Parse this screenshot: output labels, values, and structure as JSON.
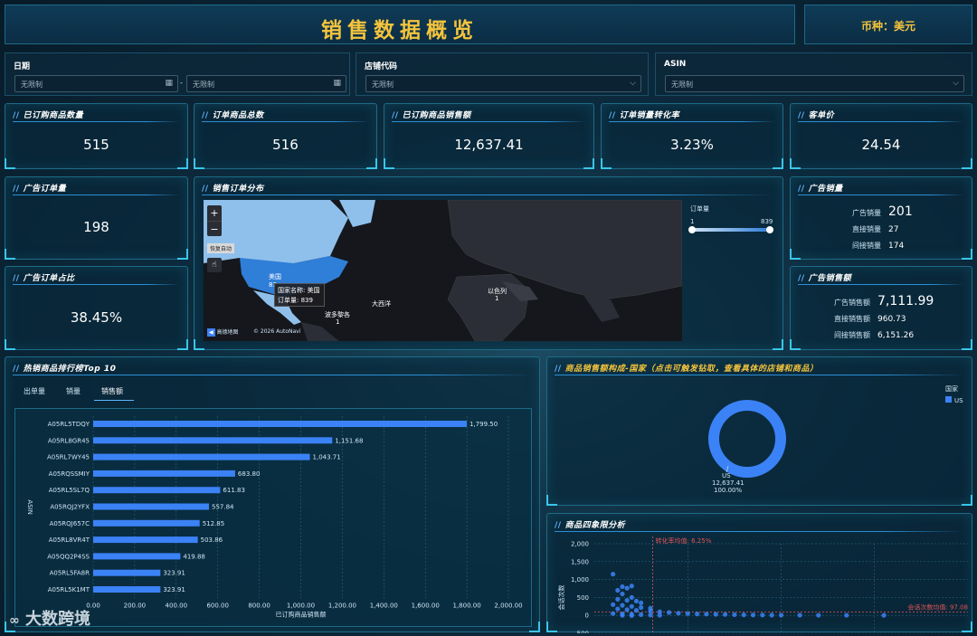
{
  "header": {
    "title": "销售数据概览",
    "currency": "币种：美元"
  },
  "filters": {
    "date": {
      "label": "日期",
      "start_placeholder": "无限制",
      "separator": "-",
      "end_placeholder": "无限制"
    },
    "store": {
      "label": "店铺代码",
      "placeholder": "无限制"
    },
    "asin": {
      "label": "ASIN",
      "placeholder": "无限制"
    }
  },
  "kpis": [
    {
      "title": "已订购商品数量",
      "value": "515"
    },
    {
      "title": "订单商品总数",
      "value": "516"
    },
    {
      "title": "已订购商品销售额",
      "value": "12,637.41"
    },
    {
      "title": "订单销量转化率",
      "value": "3.23%"
    },
    {
      "title": "客单价",
      "value": "24.54"
    }
  ],
  "ad_orders": {
    "title": "广告订单量",
    "value": "198"
  },
  "ad_ratio": {
    "title": "广告订单占比",
    "value": "38.45%"
  },
  "map": {
    "title": "销售订单分布",
    "zoom_in": "+",
    "zoom_out": "−",
    "reset": "恢复自动",
    "legend_title": "订单量",
    "legend_min": "1",
    "legend_max": "839",
    "labels": {
      "us": "美国",
      "us_sub": "83",
      "mexico": "墨",
      "atlantic": "大西洋",
      "israel": "以色列",
      "israel_sub": "1",
      "trinidad": "波多黎各",
      "trinidad_sub": "1"
    },
    "tooltip": {
      "line1": "国家名称: 美国",
      "line2": "订单量: 839"
    },
    "credit": "© 2026 AutoNavi",
    "logo_text": "高德地图",
    "colors": {
      "highlight": "#2f7ed8",
      "land_light": "#8fc0ec",
      "ocean": "#15171c",
      "land": "#2b2e36"
    }
  },
  "ad_sales_qty": {
    "title": "广告销量",
    "rows": [
      {
        "label": "广告销量",
        "value": "201"
      },
      {
        "label": "直接销量",
        "value": "27"
      },
      {
        "label": "间接销量",
        "value": "174"
      }
    ]
  },
  "ad_sales_amt": {
    "title": "广告销售额",
    "rows": [
      {
        "label": "广告销售额",
        "value": "7,111.99"
      },
      {
        "label": "直接销售额",
        "value": "960.73"
      },
      {
        "label": "间接销售额",
        "value": "6,151.26"
      }
    ]
  },
  "top10": {
    "title": "热销商品排行榜Top 10",
    "tabs": [
      "出单量",
      "销量",
      "销售额"
    ],
    "active_tab": 2,
    "chart_data": {
      "type": "bar",
      "orientation": "horizontal",
      "categories": [
        "A05RL5TDQY",
        "A05RL8GR45",
        "A05RL7WY45",
        "A05RQSSMIY",
        "A05RL5SL7Q",
        "A05RQJ2YFX",
        "A05RQJ657C",
        "A05RL8VR4T",
        "A05QQ2P4SS",
        "A05RL5FA8R",
        "A05RL5K1MT"
      ],
      "values": [
        1799.5,
        1151.68,
        1043.71,
        683.8,
        611.83,
        557.84,
        512.85,
        503.86,
        419.88,
        323.91,
        323.91
      ],
      "value_labels": [
        "1,799.50",
        "1,151.68",
        "1,043.71",
        "683.80",
        "611.83",
        "557.84",
        "512.85",
        "503.86",
        "419.88",
        "323.91",
        "323.91"
      ],
      "xticks": [
        "0.00",
        "200.00",
        "400.00",
        "600.00",
        "800.00",
        "1,000.00",
        "1,200.00",
        "1,400.00",
        "1,600.00",
        "1,800.00",
        "2,000.00"
      ],
      "xlim": [
        0,
        2000
      ],
      "xlabel": "已订购商品销售额",
      "ylabel": "ASIN",
      "color": "#3b82f6"
    }
  },
  "country": {
    "title": "商品销售额构成-国家（点击可触发钻取，查看具体的店铺和商品）",
    "legend_title": "国家",
    "chart_data": {
      "type": "pie",
      "style": "donut",
      "slices": [
        {
          "name": "US",
          "value": 12637.41,
          "value_label": "12,637.41",
          "percent": "100.00%"
        }
      ],
      "legend": "top-right",
      "color": "#3b82f6"
    }
  },
  "quadrant": {
    "title": "商品四象限分析",
    "chart_data": {
      "type": "scatter",
      "yticks": [
        "2,000",
        "1,500",
        "1,000",
        "500",
        "0",
        "-500"
      ],
      "ylim": [
        -500,
        2000
      ],
      "ylabel": "会话次数",
      "conv_avg_label": "转化率均值: 6.25%",
      "session_avg_label": "会话次数均值: 97.08",
      "session_avg": 97.08,
      "conv_avg": 6.25,
      "xlim": [
        0,
        40
      ],
      "points": [
        [
          2,
          1150
        ],
        [
          3,
          800
        ],
        [
          3.5,
          760
        ],
        [
          4,
          820
        ],
        [
          2.5,
          700
        ],
        [
          3,
          600
        ],
        [
          4,
          500
        ],
        [
          2.5,
          450
        ],
        [
          3.5,
          420
        ],
        [
          4.5,
          400
        ],
        [
          5,
          350
        ],
        [
          2,
          300
        ],
        [
          3,
          280
        ],
        [
          4,
          250
        ],
        [
          5,
          220
        ],
        [
          6,
          200
        ],
        [
          2.5,
          180
        ],
        [
          3.5,
          160
        ],
        [
          4.5,
          140
        ],
        [
          6,
          120
        ],
        [
          7,
          100
        ],
        [
          8,
          80
        ],
        [
          9,
          60
        ],
        [
          10,
          50
        ],
        [
          11,
          40
        ],
        [
          12,
          35
        ],
        [
          13,
          30
        ],
        [
          14,
          25
        ],
        [
          15,
          20
        ],
        [
          16,
          15
        ],
        [
          17,
          12
        ],
        [
          18,
          10
        ],
        [
          19,
          8
        ],
        [
          20,
          6
        ],
        [
          22,
          5
        ],
        [
          24,
          4
        ],
        [
          27,
          3
        ],
        [
          31,
          2
        ],
        [
          2,
          50
        ],
        [
          3,
          40
        ],
        [
          4,
          30
        ],
        [
          5,
          20
        ],
        [
          6,
          10
        ],
        [
          7,
          5
        ],
        [
          3,
          0
        ],
        [
          4,
          -5
        ]
      ]
    }
  },
  "watermark": "大数跨境"
}
